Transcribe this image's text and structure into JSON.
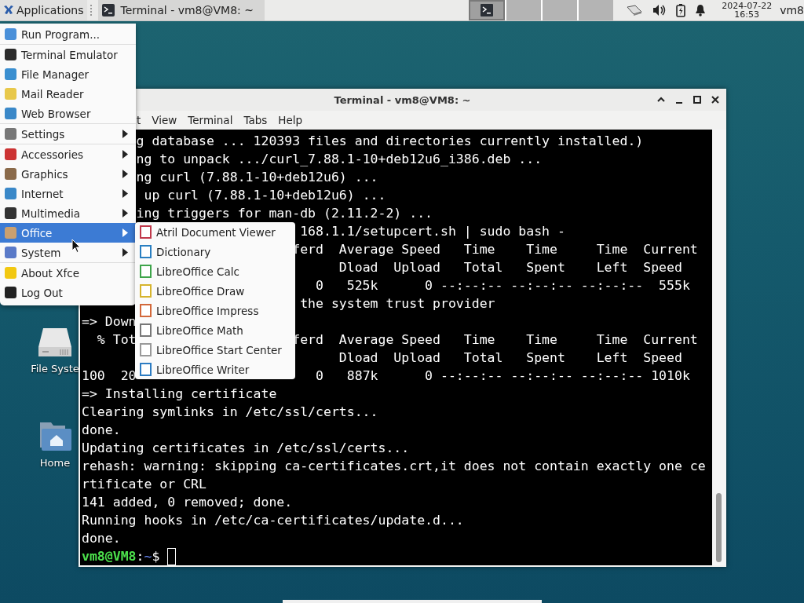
{
  "panel": {
    "applications": "Applications",
    "tasks": [
      {
        "label": "Terminal - vm8@VM8: ~",
        "selected": true
      }
    ],
    "workspaces": [
      {
        "selected": true,
        "has_window": true
      },
      {
        "selected": false,
        "has_window": false
      },
      {
        "selected": false,
        "has_window": false
      },
      {
        "selected": false,
        "has_window": false
      }
    ],
    "date": "2024-07-22",
    "time": "16:53",
    "user": "vm8"
  },
  "desktop_icons": [
    {
      "kind": "drive",
      "label": "File Syste"
    },
    {
      "kind": "home",
      "label": "Home"
    }
  ],
  "terminal": {
    "title": "Terminal - vm8@VM8: ~",
    "menu": [
      "t",
      "View",
      "Terminal",
      "Tabs",
      "Help"
    ],
    "lines": [
      "       g database ... 120393 files and directories currently installed.)",
      "       ng to unpack .../curl_7.88.1-10+deb12u6_i386.deb ...",
      "       ng curl (7.88.1-10+deb12u6) ...",
      "        up curl (7.88.1-10+deb12u6) ...",
      "       ing triggers for man-db (2.11.2-2) ...",
      "                            168.1.1/setupcert.sh | sudo bash -",
      "                           ferd  Average Speed   Time    Time     Time  Current",
      "                                 Dload  Upload   Total   Spent    Left  Speed",
      "                              0   525k      0 --:--:-- --:--:-- --:--:--  555k",
      "                            the system trust provider",
      "=> Down",
      "  % Tot                    ferd  Average Speed   Time    Time     Time  Current",
      "                                 Dload  Upload   Total   Spent    Left  Speed",
      "100  20                       0   887k      0 --:--:-- --:--:-- --:--:-- 1010k",
      "=> Installing certificate",
      "Clearing symlinks in /etc/ssl/certs...",
      "done.",
      "Updating certificates in /etc/ssl/certs...",
      "rehash: warning: skipping ca-certificates.crt,it does not contain exactly one ce",
      "rtificate or CRL",
      "141 added, 0 removed; done.",
      "Running hooks in /etc/ca-certificates/update.d...",
      "done."
    ],
    "prompt": {
      "user_host": "vm8@VM8",
      "sep": ":",
      "path": "~",
      "symbol": "$"
    }
  },
  "app_menu": [
    {
      "kind": "item",
      "label": "Run Program...",
      "selected": false
    },
    {
      "kind": "separator"
    },
    {
      "kind": "item",
      "label": "Terminal Emulator",
      "selected": false
    },
    {
      "kind": "item",
      "label": "File Manager",
      "selected": false
    },
    {
      "kind": "item",
      "label": "Mail Reader",
      "selected": false
    },
    {
      "kind": "item",
      "label": "Web Browser",
      "selected": false
    },
    {
      "kind": "separator"
    },
    {
      "kind": "submenu",
      "label": "Settings",
      "selected": false
    },
    {
      "kind": "separator"
    },
    {
      "kind": "submenu",
      "label": "Accessories",
      "selected": false
    },
    {
      "kind": "submenu",
      "label": "Graphics",
      "selected": false
    },
    {
      "kind": "submenu",
      "label": "Internet",
      "selected": false
    },
    {
      "kind": "submenu",
      "label": "Multimedia",
      "selected": false
    },
    {
      "kind": "submenu",
      "label": "Office",
      "selected": true
    },
    {
      "kind": "submenu",
      "label": "System",
      "selected": false
    },
    {
      "kind": "separator"
    },
    {
      "kind": "item",
      "label": "About Xfce",
      "selected": false
    },
    {
      "kind": "item",
      "label": "Log Out",
      "selected": false
    }
  ],
  "office_menu": [
    "Atril Document Viewer",
    "Dictionary",
    "LibreOffice Calc",
    "LibreOffice Draw",
    "LibreOffice Impress",
    "LibreOffice Math",
    "LibreOffice Start Center",
    "LibreOffice Writer"
  ]
}
